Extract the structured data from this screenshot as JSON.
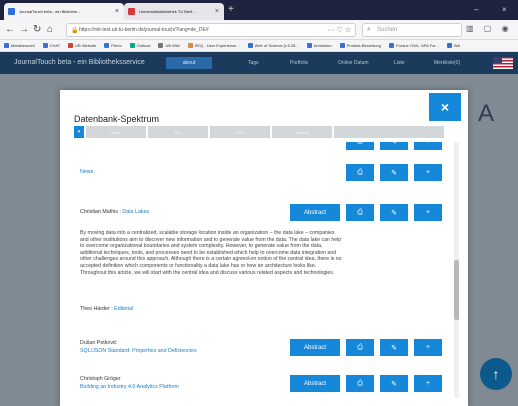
{
  "browser": {
    "tabs": [
      {
        "label": "JournalTouch beta - ein Bibliothe..."
      },
      {
        "label": "Universitätsbibliothek TU Berli..."
      }
    ],
    "new_tab": "+",
    "minimize": "–",
    "close": "×",
    "url": "https://mit-test.ub.tu-berlin.de/journal-touch/?lang=de_DE#",
    "search_placeholder": "Suchen",
    "bookmarks": [
      "Meistbesucht",
      "CHAT",
      "UB Website",
      "Primo",
      "Outlook",
      "UB Wiki",
      "SEQ - User Experience...",
      "Web of Science [v.5.28...",
      "Anmelden",
      "Produkt-Bewertung",
      "Purdue OWL: APA For...",
      "WA"
    ]
  },
  "app": {
    "brand": "JournalTouch beta - ein Bibliotheksservice",
    "about": "about",
    "nav": [
      "Tags",
      "Portfolio",
      "Online Datum",
      "Liste",
      "Merkliste(0)"
    ]
  },
  "backdrop_letter": "A",
  "fab_icon": "↑",
  "modal": {
    "title": "Datenbank-Spektrum",
    "close": "×",
    "filter_toggle": "▾",
    "filters": [
      "Home",
      "TOC",
      "RSS",
      "Journal"
    ],
    "action_icons": {
      "pdf": "⎙",
      "pin": "✎",
      "add": "+"
    },
    "entries": [
      {
        "author": "",
        "title": "News",
        "has_abstract": false
      },
      {
        "author": "Christian Mathis",
        "title": "Data Lakes",
        "has_abstract": true,
        "abstract_label": "Abstract"
      },
      {
        "author": "Theo Härder",
        "title": "Editorial",
        "has_abstract": false
      },
      {
        "author": "Dušan Petković",
        "title": "SQL/JSON Standard: Properties and Deficiencies",
        "has_abstract": true,
        "abstract_label": "Abstract"
      },
      {
        "author": "Christoph Gröger",
        "title": "Building an Industry 4.0 Analytics Platform",
        "has_abstract": true,
        "abstract_label": "Abstract"
      }
    ],
    "abstract_lines": [
      "By moving data into a centralized, scalable storage location inside an organization – the data lake – companies",
      "and other institutions aim to discover new information and to generate value from the data. The data lake can help",
      "to overcome organizational boundaries and system complexity. However, to generate value from the data,",
      "additional techniques, tools, and processes need to be established which help to overcome data integration and",
      "other challenges around this approach. Although there is a certain agreed-on notion of the central idea, there is no",
      "accepted definition which components or functionality a data lake has or how an architecture looks like.",
      "Throughout this article, we will start with the central idea and discuss various related aspects and technologies."
    ]
  }
}
